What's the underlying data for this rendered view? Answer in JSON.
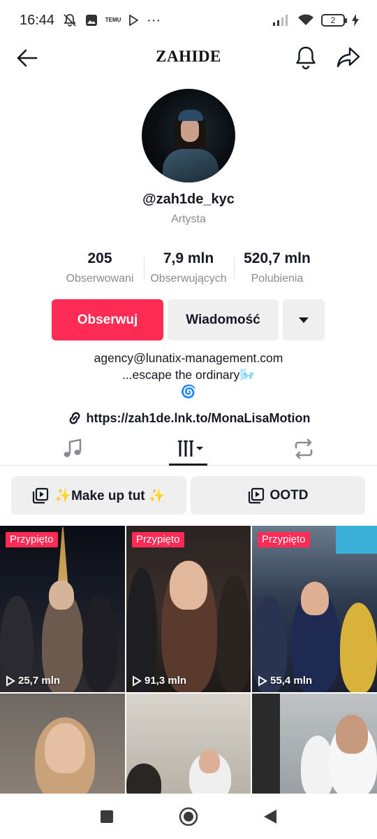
{
  "status_bar": {
    "time": "16:44",
    "temu_label": "TEMU",
    "more_dots": "···",
    "battery_level": "2",
    "icons": [
      "mute-bell-icon",
      "gallery-icon",
      "temu-icon",
      "play-store-icon",
      "signal-icon",
      "wifi-icon",
      "battery-icon",
      "charging-icon"
    ]
  },
  "header": {
    "title": "ZAHIDE",
    "icons": [
      "back-arrow-icon",
      "bell-icon",
      "share-icon"
    ]
  },
  "profile": {
    "username": "@zah1de_kyc",
    "category": "Artysta"
  },
  "stats": [
    {
      "value": "205",
      "label": "Obserwowani"
    },
    {
      "value": "7,9 mln",
      "label": "Obserwujących"
    },
    {
      "value": "520,7 mln",
      "label": "Polubienia"
    }
  ],
  "actions": {
    "follow": "Obserwuj",
    "message": "Wiadomość",
    "more_icon": "caret-down-icon"
  },
  "bio": {
    "line1": "agency@lunatix-management.com",
    "line2": "...escape the ordinary🌬️",
    "line3": "🌀",
    "link": "https://zah1de.lnk.to/MonaLisaMotion"
  },
  "tabs": [
    {
      "name": "music",
      "icon": "music-note-icon"
    },
    {
      "name": "videos",
      "icon": "grid-filter-icon",
      "active": true
    },
    {
      "name": "reposts",
      "icon": "repost-icon"
    }
  ],
  "playlists": [
    {
      "label": "✨Make up tut ✨",
      "icon": "playlist-icon"
    },
    {
      "label": "OOTD",
      "icon": "playlist-icon"
    }
  ],
  "videos": [
    {
      "pinned_label": "Przypięto",
      "views": "25,7 mln"
    },
    {
      "pinned_label": "Przypięto",
      "views": "91,3 mln"
    },
    {
      "pinned_label": "Przypięto",
      "views": "55,4 mln"
    },
    {
      "pinned_label": "",
      "views": ""
    },
    {
      "pinned_label": "",
      "views": ""
    },
    {
      "pinned_label": "",
      "views": ""
    }
  ],
  "navbar": {
    "icons": [
      "recent-apps-icon",
      "home-icon",
      "back-triangle-icon"
    ]
  },
  "colors": {
    "accent": "#fe2c55",
    "secondary_button": "#efeff0",
    "muted_text": "#8a8b91",
    "text": "#161823"
  }
}
